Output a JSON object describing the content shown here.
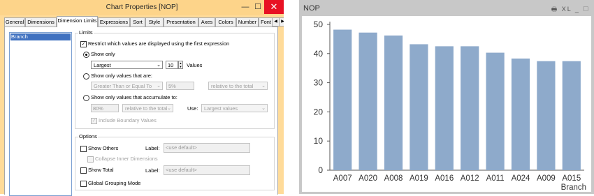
{
  "dialog": {
    "title": "Chart Properties [NOP]",
    "minimize_glyph": "—",
    "maximize_glyph": "☐",
    "close_glyph": "✕",
    "tabs": [
      "General",
      "Dimensions",
      "Dimension Limits",
      "Expressions",
      "Sort",
      "Style",
      "Presentation",
      "Axes",
      "Colors",
      "Number",
      "Font"
    ],
    "active_tab": "Dimension Limits",
    "tab_left_arrow": "◀",
    "tab_right_arrow": "▶",
    "dimensions": [
      "Branch"
    ],
    "limits": {
      "group_title": "Limits",
      "restrict_label": "Restrict which values are displayed using the first expression",
      "restrict_checked": true,
      "show_only_label": "Show only",
      "show_only_mode": "Largest",
      "show_only_count": "10",
      "values_label": "Values",
      "values_are_label": "Show only values that are:",
      "comparison": "Greater Than or Equal To",
      "percent": "5%",
      "relative": "relative to the total",
      "accumulate_label": "Show only values that accumulate to:",
      "acc_percent": "80%",
      "acc_relative": "relative to the total",
      "use_label": "Use:",
      "use_value": "Largest values",
      "include_boundary_label": "Include Boundary Values",
      "include_boundary_checked": true
    },
    "options": {
      "group_title": "Options",
      "show_others_label": "Show Others",
      "label_caption": "Label:",
      "others_placeholder": "<use default>",
      "collapse_label": "Collapse Inner Dimensions",
      "show_total_label": "Show Total",
      "total_placeholder": "<use default>",
      "global_grouping_label": "Global Grouping Mode"
    },
    "check_glyph": "✓",
    "dropdown_glyph": "⌄",
    "spin_up_glyph": "▲",
    "spin_down_glyph": "▼"
  },
  "chart_window": {
    "title": "NOP",
    "icons": [
      "print-icon",
      "xl-export-icon",
      "minimize-icon",
      "maximize-icon"
    ],
    "icon_glyphs": "🖶 XL _ ▢"
  },
  "chart_data": {
    "type": "bar",
    "categories": [
      "A007",
      "A020",
      "A008",
      "A019",
      "A016",
      "A012",
      "A011",
      "A024",
      "A009",
      "A015"
    ],
    "values": [
      48.2,
      47.2,
      46.2,
      43.2,
      42.5,
      42.5,
      40.3,
      38.3,
      37.4,
      37.4
    ],
    "xlabel": "Branch",
    "ylabel": "",
    "ylim": [
      0,
      50
    ],
    "yticks": [
      0,
      10,
      20,
      30,
      40,
      50
    ],
    "grid": false,
    "bar_color": "#8eaacb"
  }
}
